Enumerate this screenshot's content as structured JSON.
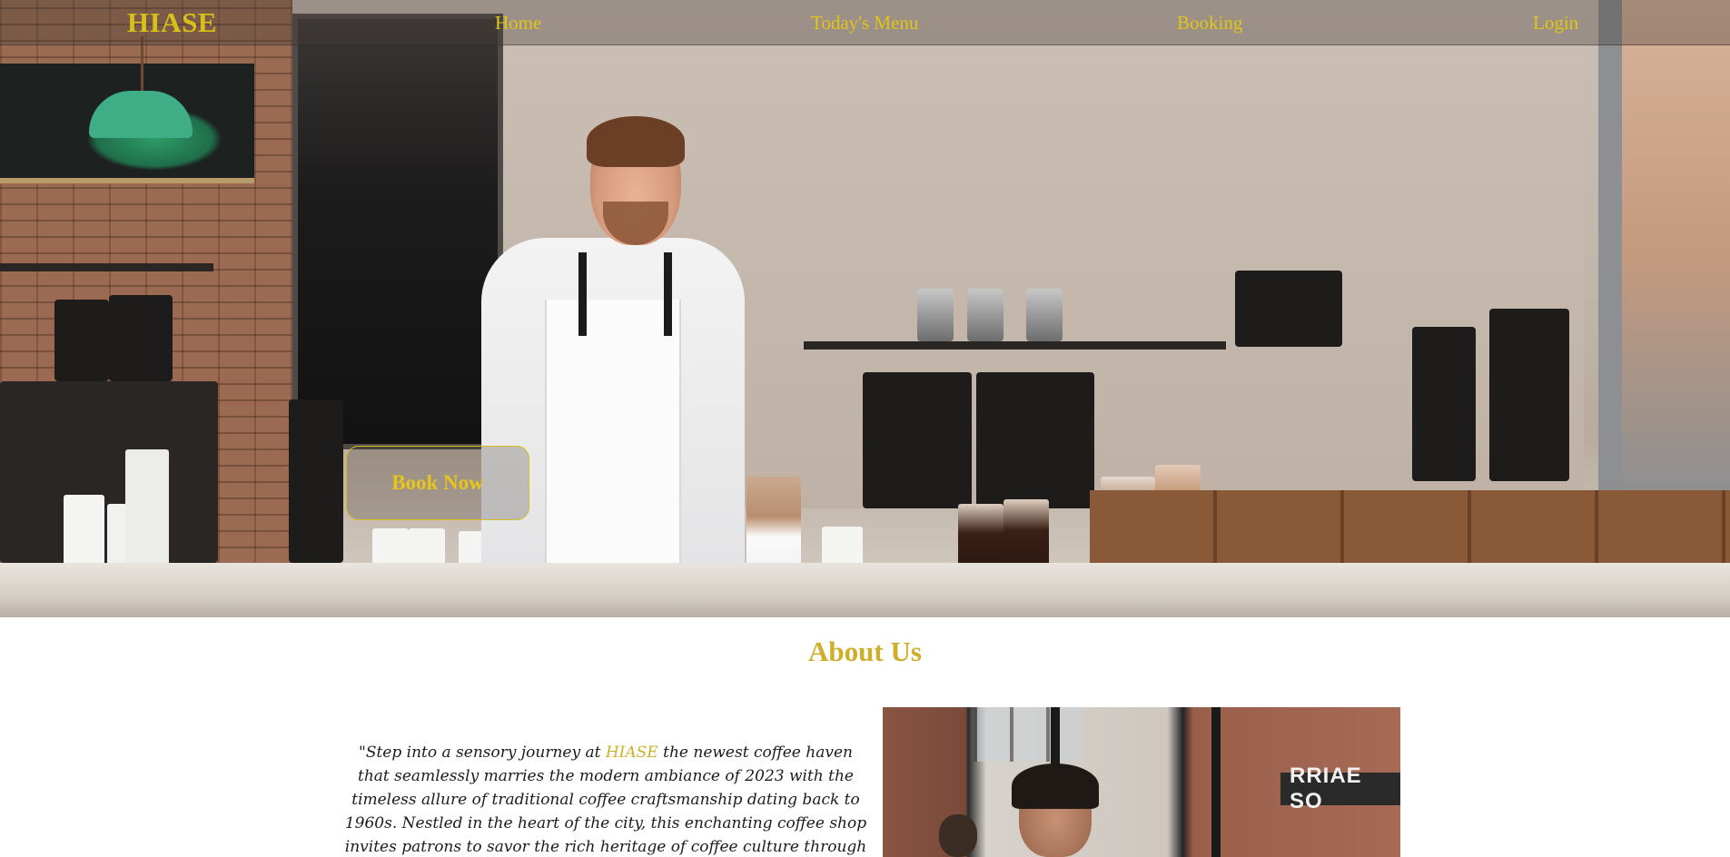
{
  "nav": {
    "logo": "HIASE",
    "links": [
      {
        "label": "Home"
      },
      {
        "label": "Today's Menu"
      },
      {
        "label": "Booking"
      },
      {
        "label": "Login"
      }
    ]
  },
  "hero": {
    "book_button": "Book Now"
  },
  "about": {
    "title": "About Us",
    "text_before": "\"Step into a sensory journey at ",
    "brand": "HIASE",
    "text_after": " the newest coffee haven that seamlessly marries the modern ambiance of 2023 with the timeless allure of traditional coffee craftsmanship dating back to 1960s. Nestled in the heart of the city, this enchanting coffee shop invites patrons to savor the rich heritage of coffee culture through meticulously preserved recipes that",
    "photo_sign": "RRIAE SO"
  },
  "colors": {
    "accent": "#d9bf1a",
    "heading": "#cfae2a",
    "text": "#1c1c1c"
  }
}
